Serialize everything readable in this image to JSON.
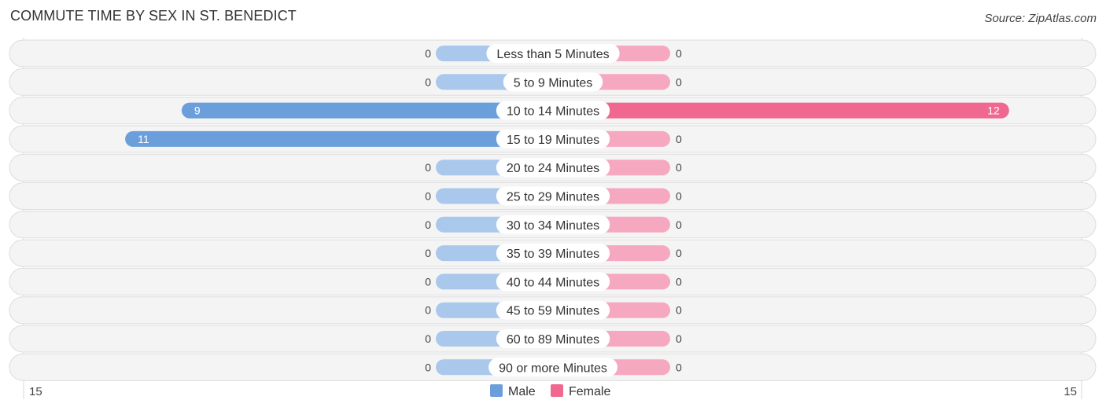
{
  "chart_data": {
    "type": "bar",
    "orientation": "horizontal-diverging",
    "title": "COMMUTE TIME BY SEX IN ST. BENEDICT",
    "source": "Source: ZipAtlas.com",
    "categories": [
      "Less than 5 Minutes",
      "5 to 9 Minutes",
      "10 to 14 Minutes",
      "15 to 19 Minutes",
      "20 to 24 Minutes",
      "25 to 29 Minutes",
      "30 to 34 Minutes",
      "35 to 39 Minutes",
      "40 to 44 Minutes",
      "45 to 59 Minutes",
      "60 to 89 Minutes",
      "90 or more Minutes"
    ],
    "series": [
      {
        "name": "Male",
        "color": "#6a9fdb",
        "zero_color": "#a9c8eb",
        "values": [
          0,
          0,
          9,
          11,
          0,
          0,
          0,
          0,
          0,
          0,
          0,
          0
        ]
      },
      {
        "name": "Female",
        "color": "#f06890",
        "zero_color": "#f6a8c0",
        "values": [
          0,
          0,
          12,
          0,
          0,
          0,
          0,
          0,
          0,
          0,
          0,
          0
        ]
      }
    ],
    "axis": {
      "left_label": "15",
      "right_label": "15",
      "max": 15
    },
    "legend": {
      "placement": "bottom-center",
      "items": [
        "Male",
        "Female"
      ]
    }
  }
}
